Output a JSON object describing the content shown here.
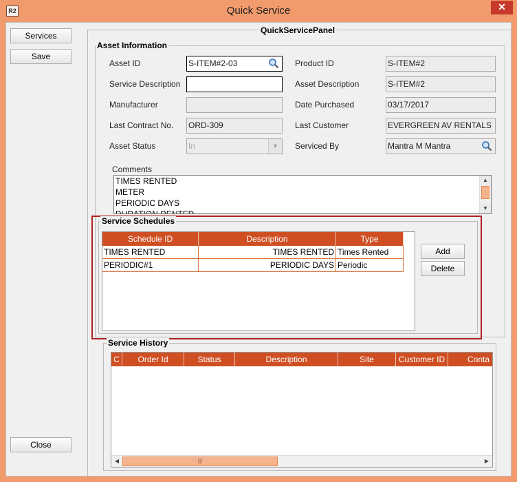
{
  "window": {
    "title": "Quick Service",
    "icon_text": "R2",
    "close_glyph": "✕"
  },
  "sidebar": {
    "services_label": "Services",
    "save_label": "Save",
    "close_label": "Close"
  },
  "panel": {
    "title": "QuickServicePanel"
  },
  "asset_info": {
    "title": "Asset Information",
    "asset_id": {
      "label": "Asset ID",
      "value": "S-ITEM#2-03"
    },
    "product_id": {
      "label": "Product ID",
      "value": "S-ITEM#2"
    },
    "service_description": {
      "label": "Service Description",
      "value": ""
    },
    "asset_description": {
      "label": "Asset Description",
      "value": "S-ITEM#2"
    },
    "manufacturer": {
      "label": "Manufacturer",
      "value": ""
    },
    "date_purchased": {
      "label": "Date Purchased",
      "value": "03/17/2017"
    },
    "last_contract": {
      "label": "Last Contract No.",
      "value": "ORD-309"
    },
    "last_customer": {
      "label": "Last Customer",
      "value": "EVERGREEN AV RENTALS"
    },
    "asset_status": {
      "label": "Asset Status",
      "value": "In"
    },
    "serviced_by": {
      "label": "Serviced By",
      "value": "Mantra M Mantra"
    },
    "comments": {
      "label": "Comments",
      "lines": [
        "TIMES RENTED",
        "METER",
        "PERIODIC DAYS",
        "DURATION RENTED"
      ]
    }
  },
  "service_schedules": {
    "title": "Service Schedules",
    "columns": [
      "Schedule ID",
      "Description",
      "Type"
    ],
    "rows": [
      [
        "TIMES RENTED",
        "TIMES RENTED",
        "Times Rented"
      ],
      [
        "PERIODIC#1",
        "PERIODIC DAYS",
        "Periodic"
      ]
    ],
    "add_label": "Add",
    "delete_label": "Delete"
  },
  "service_history": {
    "title": "Service History",
    "columns": [
      "C",
      "Order Id",
      "Status",
      "Description",
      "Site",
      "Customer ID",
      "Conta"
    ]
  },
  "colors": {
    "accent": "#cf4f23",
    "frame": "#f19a6c",
    "highlight_border": "#b22222"
  }
}
